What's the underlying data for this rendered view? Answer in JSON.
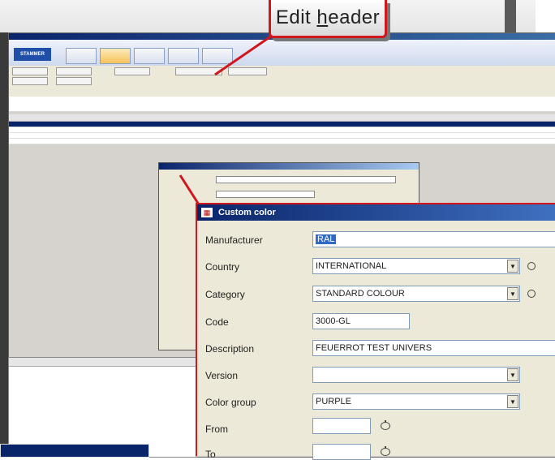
{
  "callout": {
    "text_before": "Edit ",
    "text_underlined": "h",
    "text_after": "eader"
  },
  "app": {
    "logo": "STAMMER",
    "ribbon_tabs": [
      "",
      "",
      "",
      "",
      ""
    ],
    "toolbar_buttons": [
      "",
      "",
      "",
      "",
      "",
      ""
    ]
  },
  "dialog": {
    "title": "Custom color",
    "fields": [
      {
        "label": "Manufacturer",
        "value": "RAL",
        "highlighted": true
      },
      {
        "label": "Country",
        "value": "INTERNATIONAL",
        "dropdown": true,
        "icon": "circle-icon"
      },
      {
        "label": "Category",
        "value": "STANDARD COLOUR",
        "dropdown": true,
        "icon": "circle-icon"
      },
      {
        "label": "Code",
        "value": "3000-GL"
      },
      {
        "label": "Description",
        "value": "FEUERROT TEST UNIVERS"
      },
      {
        "label": "Version",
        "value": "",
        "dropdown": true
      },
      {
        "label": "Color group",
        "value": "PURPLE",
        "dropdown": true
      },
      {
        "label": "From",
        "value": "",
        "icon": "calendar-icon"
      },
      {
        "label": "To",
        "value": "",
        "icon": "calendar-icon"
      }
    ]
  },
  "colors": {
    "accent_red": "#d0161f",
    "title_blue": "#0a246a",
    "dialog_bg": "#ece9d8",
    "selection": "#316ac5"
  }
}
